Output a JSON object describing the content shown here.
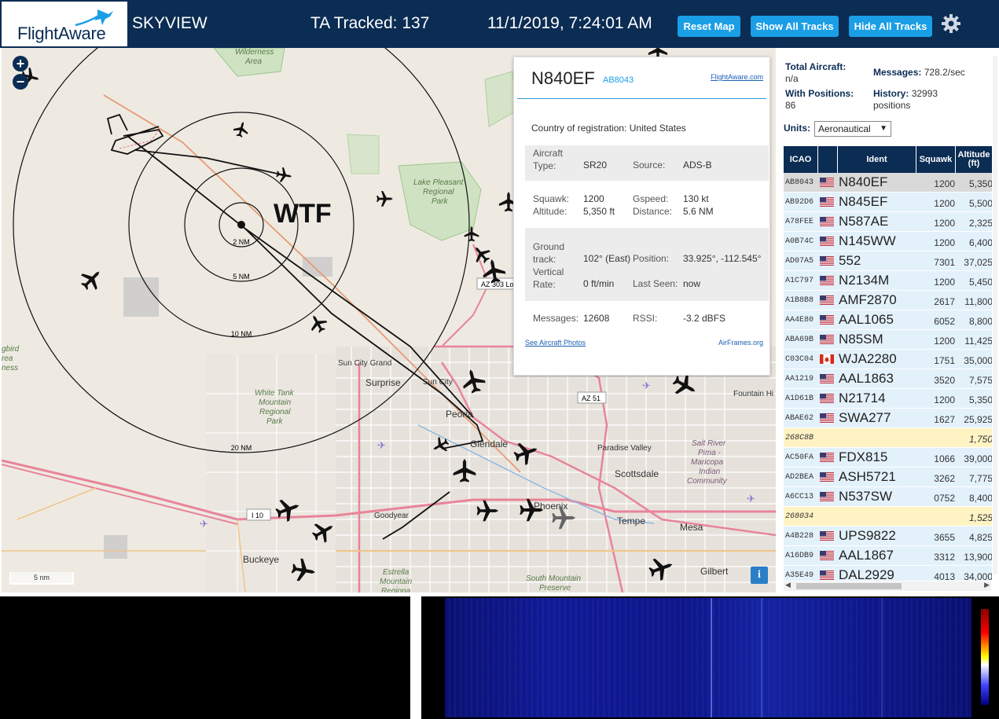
{
  "header": {
    "logo_text": "FlightAware",
    "title": "SKYVIEW",
    "tracked": "TA Tracked: 137",
    "datetime": "11/1/2019, 7:24:01 AM",
    "buttons": {
      "reset_map": "Reset Map",
      "show_all": "Show All Tracks",
      "hide_all": "Hide All Tracks"
    },
    "settings_icon": "gear-icon",
    "background_color": "#0b2c53",
    "button_color": "#1a9ee6"
  },
  "map": {
    "zoom_in": "+",
    "zoom_out": "−",
    "site_label": "WTF",
    "range_rings": [
      "2 NM",
      "5 NM",
      "10 NM",
      "20 NM"
    ],
    "scale": "5 nm",
    "info": "i",
    "places": {
      "wilderness": "Wilderness\nArea",
      "lake_pleasant": "Lake Pleasant\nRegional\nPark",
      "sun_city_grand": "Sun City Grand",
      "surprise": "Surprise",
      "sun_city": "Sun City",
      "peoria": "Peoria",
      "glendale": "Glendale",
      "white_tank": "White Tank\nMountain\nRegional\nPark",
      "paradise_valley": "Paradise Valley",
      "scottsdale": "Scottsdale",
      "salt_river": "Salt River\nPima -\nMaricopa\nIndian\nCommunity",
      "fountain_hills": "Fountain Hi",
      "phoenix": "Phoenix",
      "goodyear": "Goodyear",
      "tempe": "Tempe",
      "mesa": "Mesa",
      "buckeye": "Buckeye",
      "gilbert": "Gilbert",
      "estrella": "Estrella\nMountain\nRegiona",
      "south_mountain": "South Mountain\nPreserve",
      "gbird": "gbird\nrea\nness",
      "i10": "I 10",
      "az51": "AZ 51",
      "az303": "AZ 303 Lo"
    }
  },
  "popup": {
    "registration": "N840EF",
    "icao": "AB8043",
    "link": "FlightAware.com",
    "country_label": "Country of registration:",
    "country": "United States",
    "aircraft_type_label": "Aircraft\nType:",
    "aircraft_type": "SR20",
    "source_label": "Source:",
    "source": "ADS-B",
    "squawk_label": "Squawk:",
    "squawk": "1200",
    "altitude_label": "Altitude:",
    "altitude": "5,350 ft",
    "gspeed_label": "Gspeed:",
    "gspeed": "130 kt",
    "distance_label": "Distance:",
    "distance": "5.6 NM",
    "ground_track_label": "Ground\ntrack:",
    "ground_track": "102° (East)",
    "position_label": "Position:",
    "position": "33.925°, -112.545°",
    "vertical_rate_label": "Vertical\nRate:",
    "vertical_rate": "0 ft/min",
    "last_seen_label": "Last Seen:",
    "last_seen": "now",
    "messages_label": "Messages:",
    "messages": "12608",
    "rssi_label": "RSSI:",
    "rssi": "-3.2 dBFS",
    "photos_link": "See Aircraft Photos",
    "airframes_link": "AirFrames.org"
  },
  "stats": {
    "total_aircraft_label": "Total Aircraft:",
    "total_aircraft": "n/a",
    "messages_label": "Messages:",
    "messages": "728.2/sec",
    "with_positions_label": "With Positions:",
    "with_positions": "86",
    "history_label": "History:",
    "history": "32993\npositions"
  },
  "units": {
    "label": "Units:",
    "selected": "Aeronautical"
  },
  "table": {
    "headers": {
      "icao": "ICAO",
      "ident": "Ident",
      "squawk": "Squawk",
      "altitude": "Altitude\n(ft)"
    },
    "rows": [
      {
        "icao": "AB8043",
        "flag": "US",
        "ident": "N840EF",
        "squawk": "1200",
        "altitude": "5,350",
        "state": "selected"
      },
      {
        "icao": "AB92D6",
        "flag": "US",
        "ident": "N845EF",
        "squawk": "1200",
        "altitude": "5,500",
        "state": "normal"
      },
      {
        "icao": "A78FEE",
        "flag": "US",
        "ident": "N587AE",
        "squawk": "1200",
        "altitude": "2,325",
        "state": "normal"
      },
      {
        "icao": "A0B74C",
        "flag": "US",
        "ident": "N145WW",
        "squawk": "1200",
        "altitude": "6,400",
        "state": "normal"
      },
      {
        "icao": "AD07A5",
        "flag": "US",
        "ident": "552",
        "squawk": "7301",
        "altitude": "37,025",
        "state": "normal"
      },
      {
        "icao": "A1C797",
        "flag": "US",
        "ident": "N2134M",
        "squawk": "1200",
        "altitude": "5,450",
        "state": "normal"
      },
      {
        "icao": "A1B8B8",
        "flag": "US",
        "ident": "AMF2870",
        "squawk": "2617",
        "altitude": "11,800",
        "state": "normal"
      },
      {
        "icao": "AA4E80",
        "flag": "US",
        "ident": "AAL1065",
        "squawk": "6052",
        "altitude": "8,800",
        "state": "normal"
      },
      {
        "icao": "ABA69B",
        "flag": "US",
        "ident": "N85SM",
        "squawk": "1200",
        "altitude": "11,425",
        "state": "normal"
      },
      {
        "icao": "C03C04",
        "flag": "CA",
        "ident": "WJA2280",
        "squawk": "1751",
        "altitude": "35,000",
        "state": "normal"
      },
      {
        "icao": "AA1219",
        "flag": "US",
        "ident": "AAL1863",
        "squawk": "3520",
        "altitude": "7,575",
        "state": "normal"
      },
      {
        "icao": "A1D61B",
        "flag": "US",
        "ident": "N21714",
        "squawk": "1200",
        "altitude": "5,350",
        "state": "normal"
      },
      {
        "icao": "ABAE62",
        "flag": "US",
        "ident": "SWA277",
        "squawk": "1627",
        "altitude": "25,925",
        "state": "normal"
      },
      {
        "icao": "268C8B",
        "flag": "",
        "ident": "",
        "squawk": "",
        "altitude": "1,750",
        "state": "mlat"
      },
      {
        "icao": "AC50FA",
        "flag": "US",
        "ident": "FDX815",
        "squawk": "1066",
        "altitude": "39,000",
        "state": "normal"
      },
      {
        "icao": "AD2BEA",
        "flag": "US",
        "ident": "ASH5721",
        "squawk": "3262",
        "altitude": "7,775",
        "state": "normal"
      },
      {
        "icao": "A6CC13",
        "flag": "US",
        "ident": "N537SW",
        "squawk": "0752",
        "altitude": "8,400",
        "state": "normal"
      },
      {
        "icao": "268034",
        "flag": "",
        "ident": "",
        "squawk": "",
        "altitude": "1,525",
        "state": "mlat"
      },
      {
        "icao": "A4B228",
        "flag": "US",
        "ident": "UPS9822",
        "squawk": "3655",
        "altitude": "4,825",
        "state": "normal"
      },
      {
        "icao": "A16DB9",
        "flag": "US",
        "ident": "AAL1867",
        "squawk": "3312",
        "altitude": "13,900",
        "state": "normal"
      },
      {
        "icao": "A35E49",
        "flag": "US",
        "ident": "DAL2929",
        "squawk": "4013",
        "altitude": "34,000",
        "state": "normal"
      }
    ],
    "row_colors": {
      "selected": "#d9d9d9",
      "normal": "#e3f1fb",
      "mlat": "#fff3c4"
    }
  }
}
